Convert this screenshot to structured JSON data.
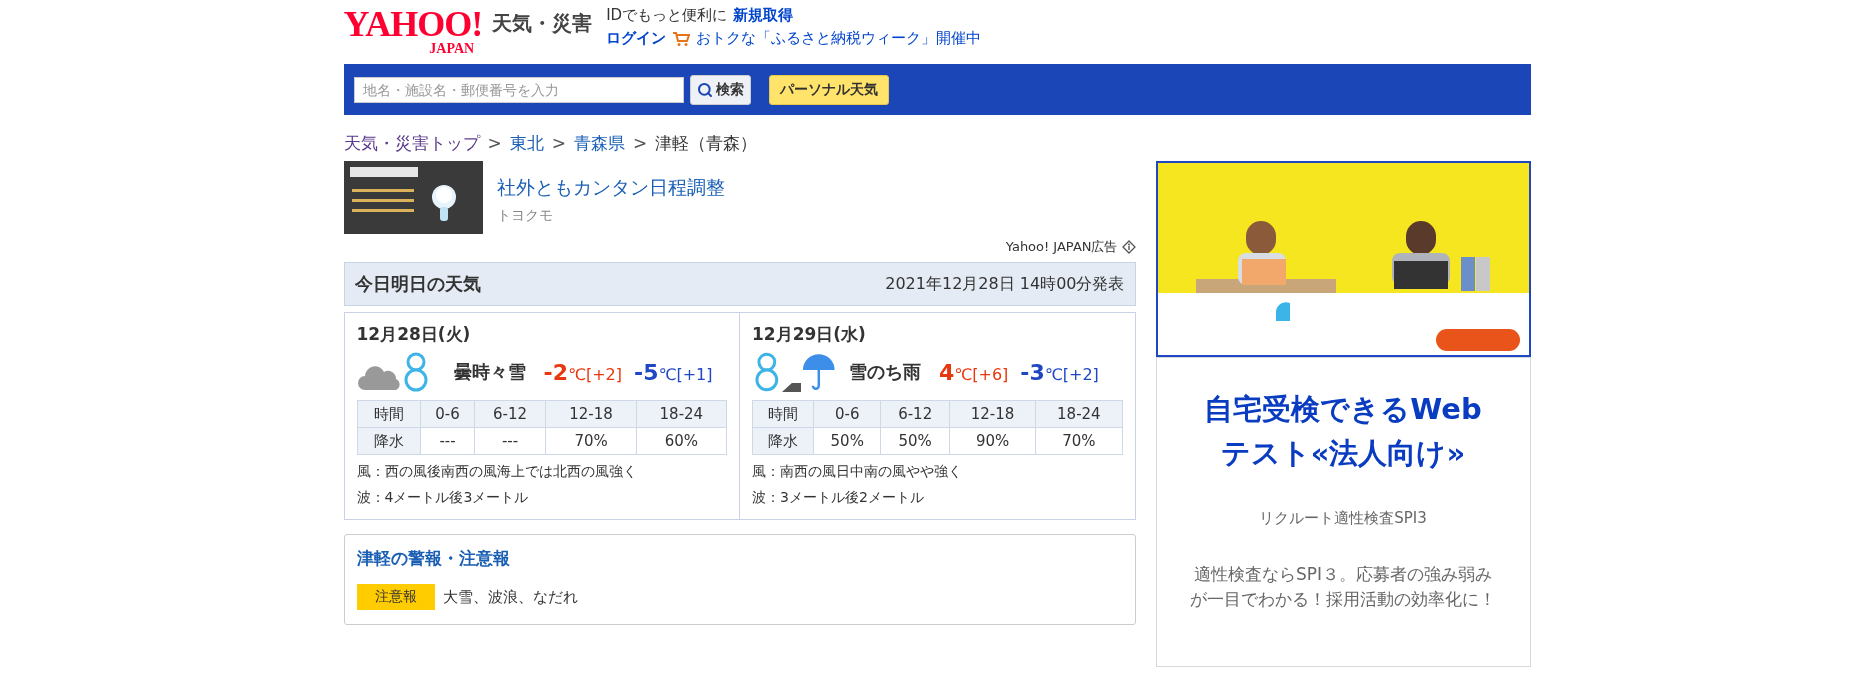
{
  "header": {
    "logo": {
      "main": "YAHOO!",
      "sub": "JAPAN"
    },
    "service": "天気・災害",
    "id_prompt": "IDでもっと便利に",
    "signup": "新規取得",
    "login": "ログイン",
    "promo": "おトクな「ふるさと納税ウィーク」開催中"
  },
  "search": {
    "placeholder": "地名・施設名・郵便番号を入力",
    "button": "検索",
    "personal": "パーソナル天気"
  },
  "breadcrumb_separator": ">",
  "breadcrumb": [
    {
      "label": "天気・災害トップ",
      "kind": "visited"
    },
    {
      "label": "東北",
      "kind": "link"
    },
    {
      "label": "青森県",
      "kind": "link"
    },
    {
      "label": "津軽（青森）",
      "kind": "current"
    }
  ],
  "ad": {
    "kind": "picture",
    "title": "社外ともカンタン日程調整",
    "advertiser": "トヨクモ",
    "label": "Yahoo! JAPAN広告"
  },
  "forecast": {
    "title": "今日明日の天気",
    "issued": "2021年12月28日 14時00分発表",
    "days": [
      {
        "date": "12月28日(火)",
        "icons": [
          {
            "kind": "cloud"
          },
          {
            "kind": "snowman"
          }
        ],
        "weather": "曇時々雪",
        "high": {
          "value": "-2",
          "unit": "℃",
          "diff": "[+2]"
        },
        "low": {
          "value": "-5",
          "unit": "℃",
          "diff": "[+1]"
        },
        "table": {
          "columns": [
            "時間",
            "0-6",
            "6-12",
            "12-18",
            "18-24"
          ],
          "rows": [
            [
              "降水",
              "---",
              "---",
              "70%",
              "60%"
            ]
          ]
        },
        "wind": "風：西の風後南西の風海上では北西の風強く",
        "wave": "波：4メートル後3メートル"
      },
      {
        "date": "12月29日(水)",
        "icons": [
          {
            "kind": "snowman"
          },
          {
            "kind": "then"
          },
          {
            "kind": "umbrella"
          }
        ],
        "weather": "雪のち雨",
        "high": {
          "value": "4",
          "unit": "℃",
          "diff": "[+6]"
        },
        "low": {
          "value": "-3",
          "unit": "℃",
          "diff": "[+2]"
        },
        "table": {
          "columns": [
            "時間",
            "0-6",
            "6-12",
            "12-18",
            "18-24"
          ],
          "rows": [
            [
              "降水",
              "50%",
              "50%",
              "90%",
              "70%"
            ]
          ]
        },
        "wind": "風：南西の風日中南の風やや強く",
        "wave": "波：3メートル後2メートル"
      }
    ]
  },
  "warnings": {
    "title": "津軽の警報・注意報",
    "items": [
      {
        "level": "注意報",
        "color": "#ffcc00",
        "text": "大雪、波浪、なだれ"
      }
    ]
  },
  "side_ad": {
    "title": "自宅受検できるWebテスト«法人向け»",
    "source": "リクルート適性検査SPI3",
    "description": "適性検査ならSPI３。応募者の強み弱みが一目でわかる！採用活動の効率化に！"
  }
}
